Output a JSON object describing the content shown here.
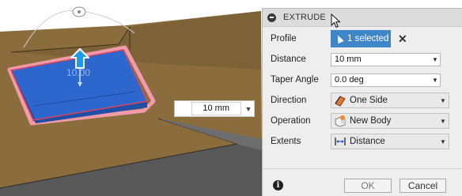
{
  "viewport": {
    "dimension_label": "10.00",
    "dimension_input": "10 mm"
  },
  "dialog": {
    "title": "EXTRUDE",
    "profile": {
      "label": "Profile",
      "selection": "1 selected"
    },
    "distance": {
      "label": "Distance",
      "value": "10 mm"
    },
    "taper_angle": {
      "label": "Taper Angle",
      "value": "0.0 deg"
    },
    "direction": {
      "label": "Direction",
      "value": "One Side",
      "icon": "one-side-icon"
    },
    "operation": {
      "label": "Operation",
      "value": "New Body",
      "icon": "new-body-icon"
    },
    "extents": {
      "label": "Extents",
      "value": "Distance",
      "icon": "distance-icon"
    },
    "buttons": {
      "ok": "OK",
      "cancel": "Cancel"
    }
  },
  "colors": {
    "ground": "#8a6c3c",
    "ground_side": "#5c5c5c",
    "profile_fill": "#2f6fd0",
    "profile_edge": "#e0506a",
    "selection_blue": "#3f86c9"
  }
}
